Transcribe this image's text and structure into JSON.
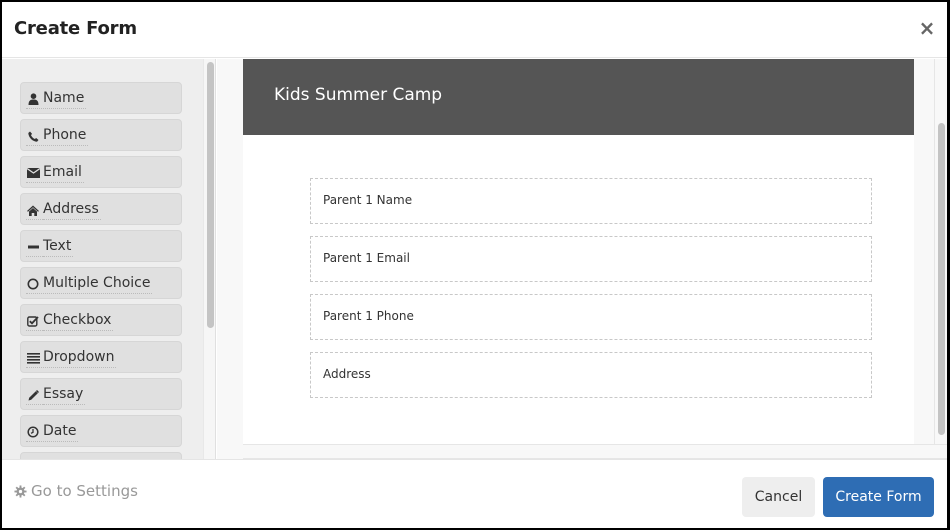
{
  "modal": {
    "title": "Create Form",
    "close_label": "×"
  },
  "palette": {
    "items": [
      {
        "label": "Name",
        "icon": "user-icon"
      },
      {
        "label": "Phone",
        "icon": "phone-icon"
      },
      {
        "label": "Email",
        "icon": "envelope-icon"
      },
      {
        "label": "Address",
        "icon": "home-icon"
      },
      {
        "label": "Text",
        "icon": "minus-icon"
      },
      {
        "label": "Multiple Choice",
        "icon": "circle-icon"
      },
      {
        "label": "Checkbox",
        "icon": "check-square-icon"
      },
      {
        "label": "Dropdown",
        "icon": "list-icon"
      },
      {
        "label": "Essay",
        "icon": "pencil-icon"
      },
      {
        "label": "Date",
        "icon": "clock-icon"
      },
      {
        "label": "",
        "icon": ""
      }
    ]
  },
  "form": {
    "title": "Kids Summer Camp",
    "fields": [
      {
        "label": "Parent 1 Name"
      },
      {
        "label": "Parent 1 Email"
      },
      {
        "label": "Parent 1 Phone"
      },
      {
        "label": "Address"
      }
    ]
  },
  "footer": {
    "settings_label": "Go to Settings",
    "cancel_label": "Cancel",
    "create_label": "Create Form"
  },
  "colors": {
    "primary": "#2e6db4",
    "form_header_bg": "#555555"
  }
}
